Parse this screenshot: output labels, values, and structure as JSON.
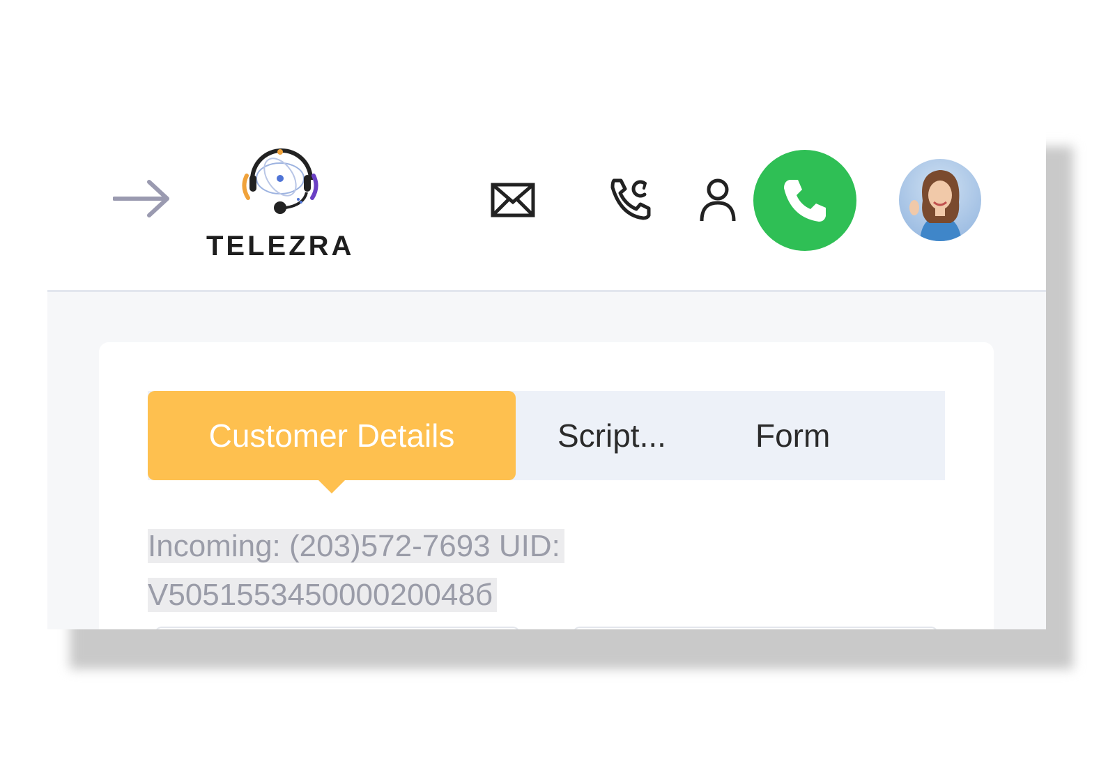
{
  "brand": {
    "name": "TELEZRA"
  },
  "header": {
    "icons": [
      "arrow-right-icon",
      "mail-icon",
      "phone-callback-icon",
      "user-icon",
      "phone-icon"
    ],
    "call_button_color": "#2fbf55"
  },
  "tabs": [
    {
      "label": "Customer Details",
      "active": true
    },
    {
      "label": "Script...",
      "active": false
    },
    {
      "label": "Form",
      "active": false
    }
  ],
  "active_tab_color": "#fec04f",
  "call_info": {
    "line1": "Incoming: (203)572-7693 UID:",
    "line2": "V505155345000020048б"
  }
}
